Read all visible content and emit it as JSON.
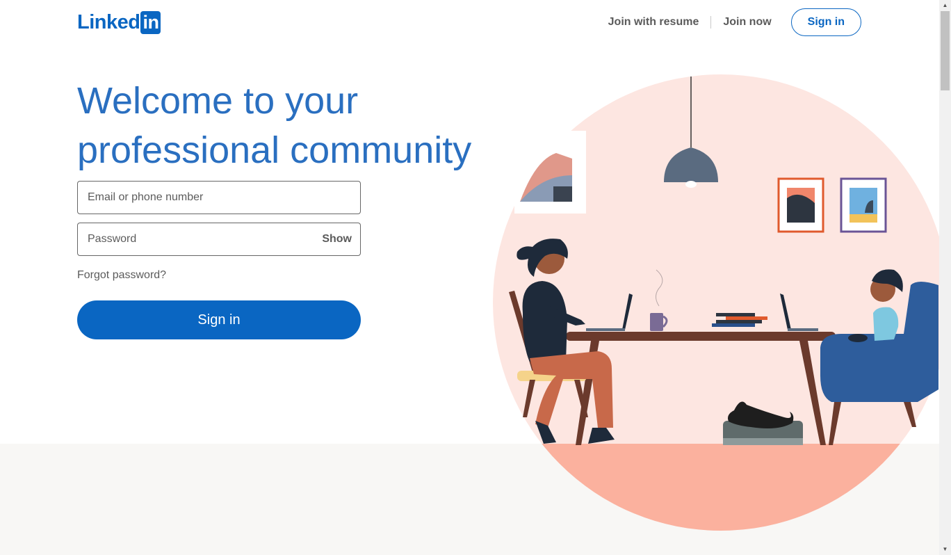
{
  "header": {
    "logo_text": "Linked",
    "logo_box": "in",
    "nav": {
      "join_with_resume": "Join with resume",
      "join_now": "Join now",
      "sign_in": "Sign in"
    }
  },
  "hero": {
    "headline_line1": "Welcome to your",
    "headline_line2": "professional community"
  },
  "form": {
    "email_placeholder": "Email or phone number",
    "email_value": "",
    "password_placeholder": "Password",
    "password_value": "",
    "show_label": "Show",
    "forgot_label": "Forgot password?",
    "signin_label": "Sign in"
  },
  "colors": {
    "brand": "#0a66c2",
    "headline": "#2a6fc0",
    "illustration_bg": "#fde6e1",
    "floor": "#fbb19e"
  },
  "icons": {
    "scroll_up": "triangle-up-icon",
    "scroll_down": "triangle-down-icon"
  }
}
